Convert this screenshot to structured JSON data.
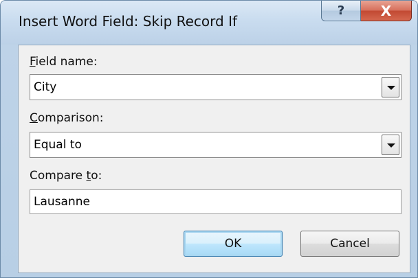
{
  "dialog": {
    "title": "Insert Word Field: Skip Record If",
    "help_glyph": "?",
    "close_glyph": "X"
  },
  "field_name": {
    "label_accel": "F",
    "label_rest": "ield name:",
    "value": "City"
  },
  "comparison": {
    "label_accel": "C",
    "label_rest": "omparison:",
    "value": "Equal to"
  },
  "compare_to": {
    "label_pre": "Compare ",
    "label_accel": "t",
    "label_rest": "o:",
    "value": "Lausanne"
  },
  "buttons": {
    "ok": "OK",
    "cancel": "Cancel"
  }
}
